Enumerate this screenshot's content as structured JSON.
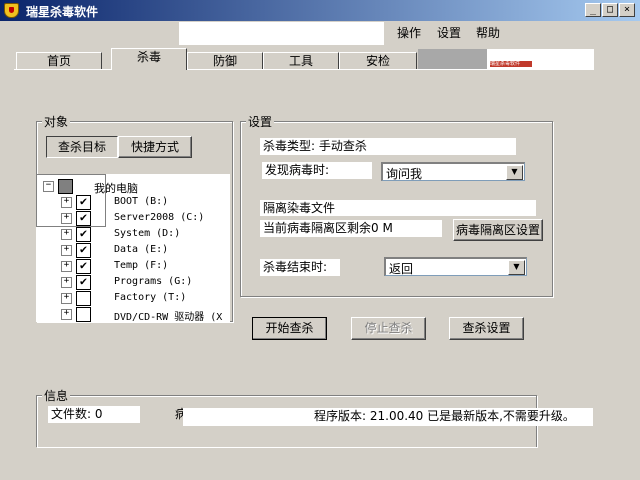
{
  "window": {
    "title": "瑞星杀毒软件",
    "min": "_",
    "max": "□",
    "close": "×"
  },
  "menu": {
    "items": [
      "操作",
      "设置",
      "帮助"
    ]
  },
  "tabs": [
    "首页",
    "杀毒",
    "防御",
    "工具",
    "安检"
  ],
  "banner_text": "瑞星杀毒软件",
  "objects": {
    "label": "对象",
    "btn_target": "查杀目标",
    "btn_shortcut": "快捷方式",
    "root": "我的电脑",
    "items": [
      {
        "label": "BOOT (B:)",
        "checked": true
      },
      {
        "label": "Server2008 (C:)",
        "checked": true
      },
      {
        "label": "System (D:)",
        "checked": true
      },
      {
        "label": "Data (E:)",
        "checked": true
      },
      {
        "label": "Temp (F:)",
        "checked": true
      },
      {
        "label": "Programs (G:)",
        "checked": true
      },
      {
        "label": "Factory (T:)",
        "checked": false
      },
      {
        "label": "DVD/CD-RW 驱动器 (X",
        "checked": false
      }
    ]
  },
  "settings": {
    "label": "设置",
    "scan_type": "杀毒类型:  手动查杀",
    "on_virus_label": "发现病毒时:",
    "on_virus_value": "询问我",
    "quarantine": "隔离染毒文件",
    "quarantine_remaining": "当前病毒隔离区剩余0 M",
    "quarantine_btn": "病毒隔离区设置",
    "on_finish_label": "杀毒结束时:",
    "on_finish_value": "返回"
  },
  "actions": {
    "start": "开始查杀",
    "stop": "停止查杀",
    "config": "查杀设置"
  },
  "info": {
    "label": "信息",
    "file_count": "文件数: 0",
    "virus_partial": "病",
    "version": "程序版本: 21.00.40  已是最新版本,不需要升级。"
  }
}
